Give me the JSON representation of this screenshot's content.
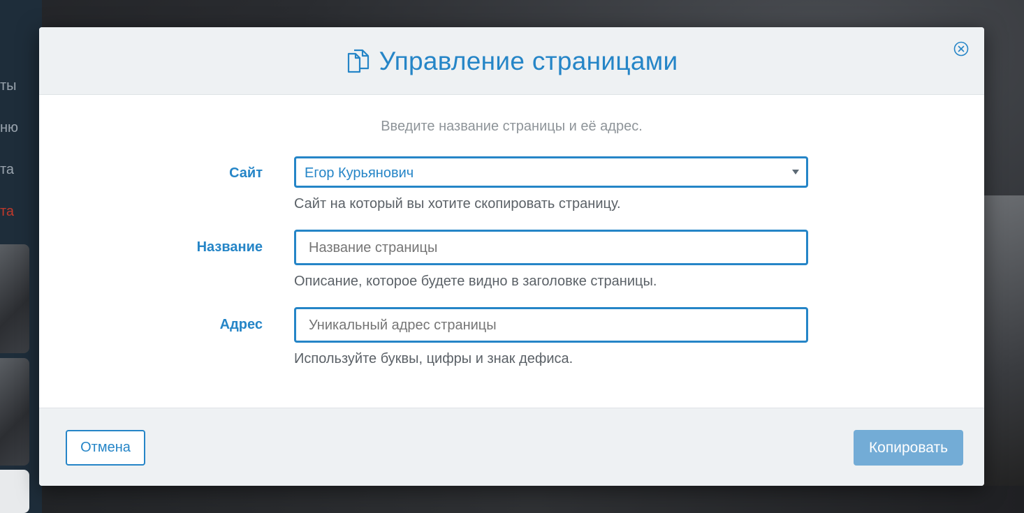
{
  "background": {
    "nav_items": [
      "ты",
      "ню",
      "та",
      "та"
    ]
  },
  "modal": {
    "title": "Управление страницами",
    "title_icon": "pages-copy-icon",
    "close_icon": "close-circle-icon",
    "intro": "Введите название страницы и её адрес.",
    "fields": {
      "site": {
        "label": "Сайт",
        "value": "Егор Курьянович",
        "help": "Сайт на который вы хотите скопировать страницу."
      },
      "name": {
        "label": "Название",
        "placeholder": "Название страницы",
        "help": "Описание, которое будете видно в заголовке страницы."
      },
      "address": {
        "label": "Адрес",
        "placeholder": "Уникальный адрес страницы",
        "help": "Используйте буквы, цифры и знак дефиса."
      }
    },
    "footer": {
      "cancel_label": "Отмена",
      "copy_label": "Копировать"
    }
  },
  "colors": {
    "accent": "#2585c7",
    "primary_button": "#73acd6",
    "header_bg": "#eef1f3",
    "background_nav_red": "#c0392b"
  }
}
